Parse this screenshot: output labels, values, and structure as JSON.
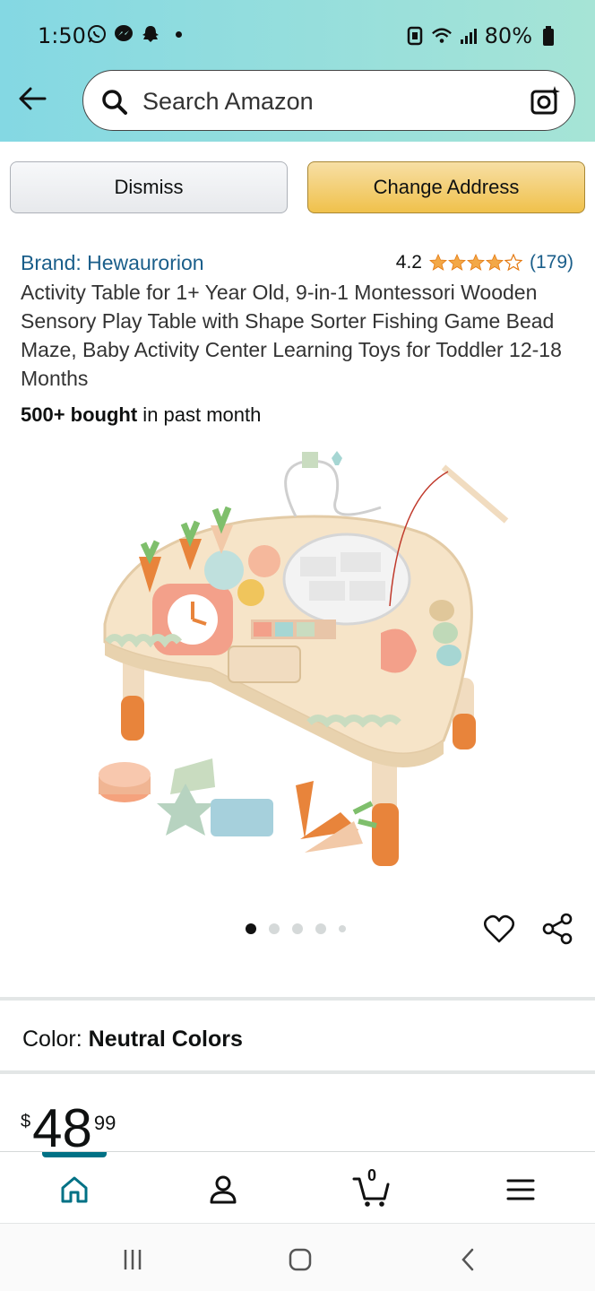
{
  "status_bar": {
    "time": "1:50",
    "battery": "80%"
  },
  "search": {
    "placeholder": "Search Amazon"
  },
  "address_banner": {
    "dismiss_label": "Dismiss",
    "change_label": "Change Address"
  },
  "product": {
    "brand": "Brand: Hewaurorion",
    "rating": "4.2",
    "rating_value": 4.2,
    "rating_count": "(179)",
    "title": "Activity Table for 1+ Year Old, 9-in-1 Montessori Wooden Sensory Play Table with Shape Sorter Fishing Game Bead Maze, Baby Activity Center Learning Toys for Toddler 12-18 Months",
    "bought_bold": "500+ bought",
    "bought_rest": " in past month",
    "image_icon": "activity-table-photo",
    "image_count": 5,
    "image_index": 1
  },
  "color": {
    "label": "Color: ",
    "value": "Neutral Colors"
  },
  "price": {
    "symbol": "$",
    "whole": "48",
    "fraction": "99"
  },
  "bottom_nav": {
    "cart_count": "0",
    "active_color": "#007185"
  },
  "colors": {
    "brand_link": "#1a5e8a",
    "star": "#f3a847",
    "change_btn": "#f0c14b"
  }
}
